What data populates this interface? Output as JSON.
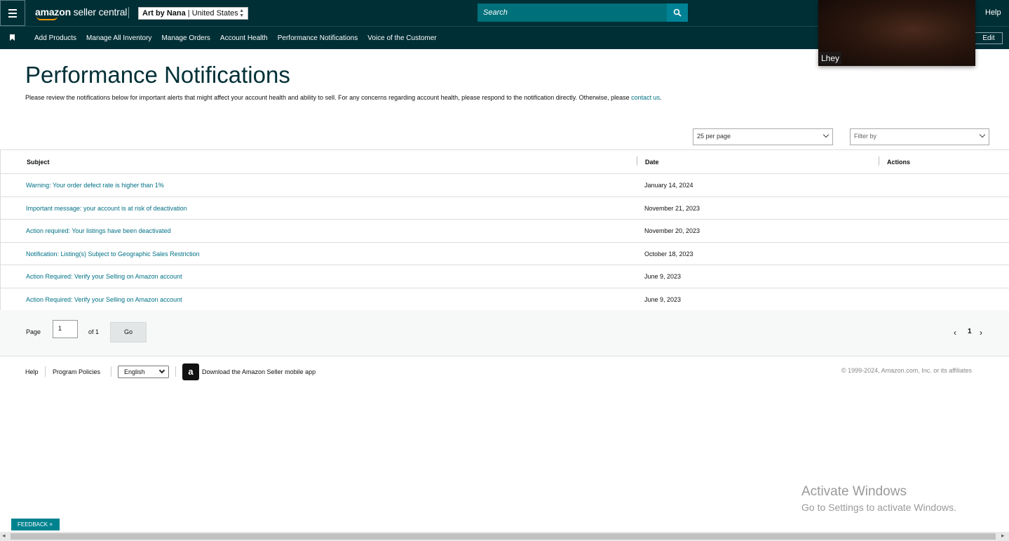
{
  "header": {
    "logo_text_1": "amazon",
    "logo_text_2": " seller central",
    "account_name": "Art by Nana",
    "account_region": " | United States",
    "search_placeholder": "Search",
    "help_label": "Help"
  },
  "nav": {
    "items": [
      "Add Products",
      "Manage All Inventory",
      "Manage Orders",
      "Account Health",
      "Performance Notifications",
      "Voice of the Customer"
    ],
    "edit_label": "Edit"
  },
  "webcam": {
    "label": "Lhey"
  },
  "page": {
    "title": "Performance Notifications",
    "intro": "Please review the notifications below for important alerts that might affect your account health and ability to sell. For any concerns regarding account health, please respond to the notification directly. Otherwise, please ",
    "contact_link": "contact us",
    "intro_end": "."
  },
  "controls": {
    "per_page": "25 per page",
    "filter_placeholder": "Filter by"
  },
  "table": {
    "headers": {
      "subject": "Subject",
      "date": "Date",
      "actions": "Actions"
    },
    "rows": [
      {
        "subject": "Warning: Your order defect rate is higher than 1%",
        "date": "January 14, 2024"
      },
      {
        "subject": "Important message: your account is at risk of deactivation",
        "date": "November 21, 2023"
      },
      {
        "subject": "Action required: Your listings have been deactivated",
        "date": "November 20, 2023"
      },
      {
        "subject": "Notification: Listing(s) Subject to Geographic Sales Restriction",
        "date": "October 18, 2023"
      },
      {
        "subject": "Action Required: Verify your Selling on Amazon account",
        "date": "June 9, 2023"
      },
      {
        "subject": "Action Required: Verify your Selling on Amazon account",
        "date": "June 9, 2023"
      }
    ]
  },
  "pager": {
    "page_label": "Page",
    "page_value": "1",
    "of_label": "of 1",
    "go_label": "Go",
    "current": "1"
  },
  "footer": {
    "help": "Help",
    "policies": "Program Policies",
    "language": "English",
    "app_text": "Download the Amazon Seller mobile app",
    "copyright": "© 1999-2024, Amazon.com, Inc. or its affiliates"
  },
  "windows": {
    "line1": "Activate Windows",
    "line2": "Go to Settings to activate Windows."
  },
  "feedback": {
    "label": "FEEDBACK"
  },
  "colors": {
    "header_bg": "#002f36",
    "link": "#007185",
    "accent": "#008296"
  }
}
